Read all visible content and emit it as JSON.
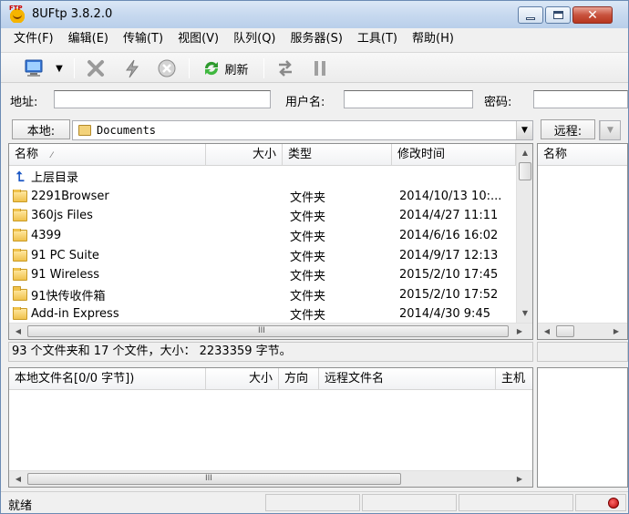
{
  "window": {
    "title": "8UFtp 3.8.2.0",
    "icon_badge": "FTP"
  },
  "menu": [
    "文件(F)",
    "编辑(E)",
    "传输(T)",
    "视图(V)",
    "队列(Q)",
    "服务器(S)",
    "工具(T)",
    "帮助(H)"
  ],
  "toolbar": {
    "refresh_label": "刷新",
    "icons": [
      "connect-icon",
      "dropdown-icon",
      "disconnect-icon",
      "quick-connect-icon",
      "cancel-icon",
      "refresh-icon",
      "transfer-icon",
      "pause-icon"
    ]
  },
  "address_bar": {
    "address_label": "地址:",
    "address_value": "",
    "user_label": "用户名:",
    "user_value": "",
    "password_label": "密码:",
    "password_value": ""
  },
  "local": {
    "tab_label": "本地:",
    "path": "Documents",
    "columns": {
      "name": "名称",
      "size": "大小",
      "type": "类型",
      "modified": "修改时间"
    },
    "rows": [
      {
        "name": "上层目录",
        "size": "",
        "type": "",
        "modified": "",
        "kind": "parent"
      },
      {
        "name": "2291Browser",
        "size": "",
        "type": "文件夹",
        "modified": "2014/10/13 10:...",
        "kind": "folder"
      },
      {
        "name": "360js Files",
        "size": "",
        "type": "文件夹",
        "modified": "2014/4/27 11:11",
        "kind": "folder"
      },
      {
        "name": "4399",
        "size": "",
        "type": "文件夹",
        "modified": "2014/6/16 16:02",
        "kind": "folder"
      },
      {
        "name": "91 PC Suite",
        "size": "",
        "type": "文件夹",
        "modified": "2014/9/17 12:13",
        "kind": "folder"
      },
      {
        "name": "91 Wireless",
        "size": "",
        "type": "文件夹",
        "modified": "2015/2/10 17:45",
        "kind": "folder"
      },
      {
        "name": "91快传收件箱",
        "size": "",
        "type": "文件夹",
        "modified": "2015/2/10 17:52",
        "kind": "folder"
      },
      {
        "name": "Add-in Express",
        "size": "",
        "type": "文件夹",
        "modified": "2014/4/30 9:45",
        "kind": "folder"
      }
    ],
    "summary": "93 个文件夹和 17 个文件，大小： 2233359 字节。"
  },
  "remote": {
    "tab_label": "远程:",
    "columns": {
      "name": "名称"
    }
  },
  "queue": {
    "columns": {
      "local_name": "本地文件名[0/0 字节])",
      "size": "大小",
      "direction": "方向",
      "remote_name": "远程文件名",
      "host": "主机"
    }
  },
  "scrollbar": {
    "grip": "III"
  },
  "status": {
    "text": "就绪"
  }
}
